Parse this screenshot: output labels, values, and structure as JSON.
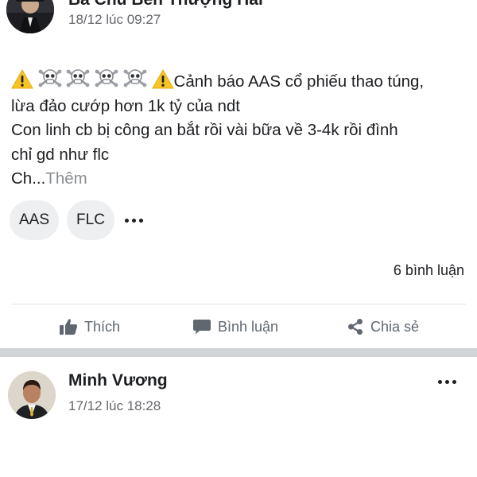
{
  "post1": {
    "author": "Bà Chủ Bến Thượng Hải",
    "timestamp": "18/12 lúc 09:27",
    "line1_text": "Cảnh báo AAS cổ phiếu thao túng,",
    "line2": "lừa đảo cướp hơn 1k tỷ của ndt",
    "line3": "Con linh cb bị công an bắt rồi vài bữa về 3-4k rồi đình",
    "line4": "chỉ gd như flc",
    "line5_prefix": "Ch...",
    "more_label": "Thêm",
    "icons": [
      "warning-icon",
      "skull-crossbones-icon",
      "skull-crossbones-icon",
      "skull-crossbones-icon",
      "skull-crossbones-icon",
      "warning-icon"
    ],
    "tags": [
      {
        "label": "AAS"
      },
      {
        "label": "FLC"
      }
    ],
    "comments_count": "6 bình luận",
    "actions": {
      "like": "Thích",
      "comment": "Bình luận",
      "share": "Chia sẻ"
    }
  },
  "post2": {
    "author": "Minh Vương",
    "timestamp": "17/12 lúc 18:28"
  },
  "colors": {
    "text": "#1c1e21",
    "secondary": "#65676b",
    "action": "#606770",
    "chip_bg": "#eeeff1",
    "separator": "#d0d3d8",
    "warning": "#f7c325"
  }
}
